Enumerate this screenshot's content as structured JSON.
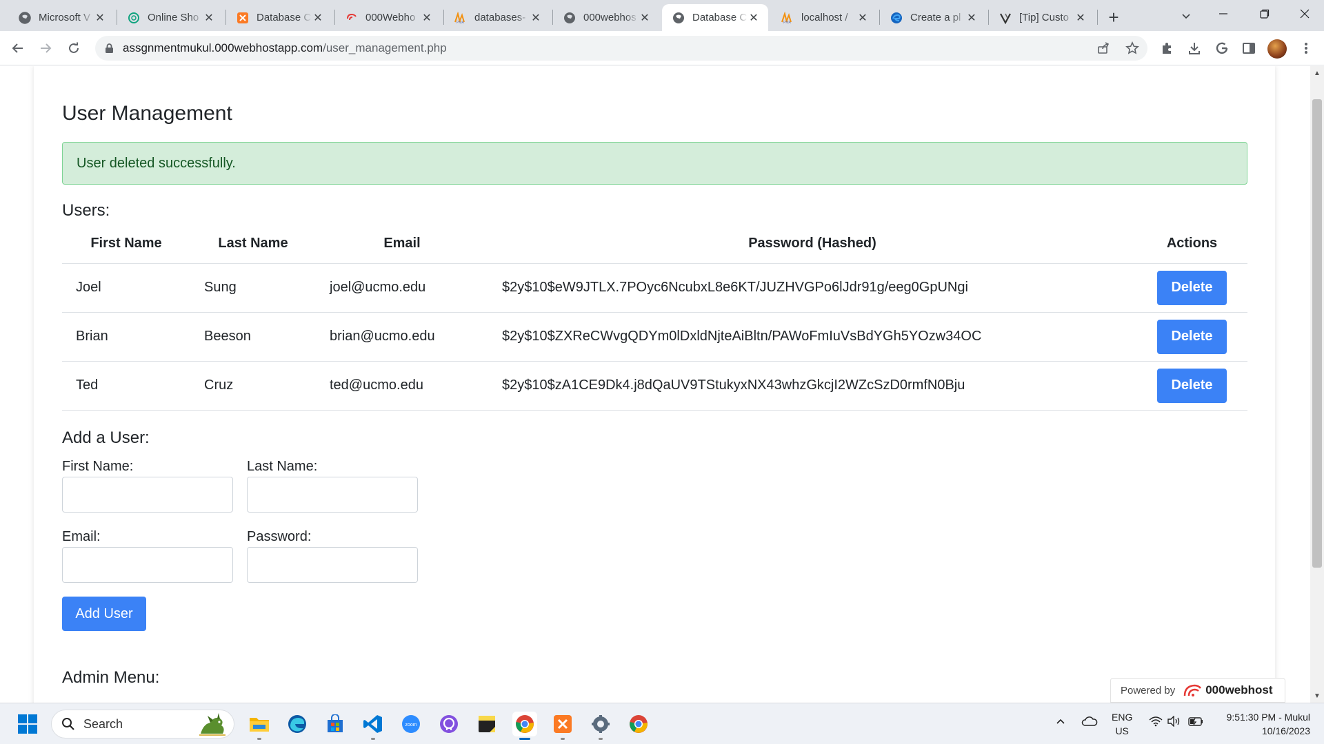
{
  "tabs": [
    {
      "title": "Microsoft V",
      "icon": "globe-icon"
    },
    {
      "title": "Online Sho",
      "icon": "openai-icon"
    },
    {
      "title": "Database C",
      "icon": "xampp-icon"
    },
    {
      "title": "000Webho",
      "icon": "webhost-icon"
    },
    {
      "title": "databases-",
      "icon": "phpmyadmin-icon"
    },
    {
      "title": "000webhos",
      "icon": "globe-icon"
    },
    {
      "title": "Database C",
      "icon": "globe-icon",
      "active": true
    },
    {
      "title": "localhost /",
      "icon": "phpmyadmin-icon"
    },
    {
      "title": "Create a pl",
      "icon": "edge-icon"
    },
    {
      "title": "[Tip] Custo",
      "icon": "tip-icon"
    }
  ],
  "address": {
    "domain": "assgnmentmukul.000webhostapp.com",
    "path": "/user_management.php"
  },
  "page": {
    "title": "User Management",
    "alert": "User deleted successfully.",
    "users_heading": "Users:",
    "table": {
      "headers": [
        "First Name",
        "Last Name",
        "Email",
        "Password (Hashed)",
        "Actions"
      ],
      "rows": [
        {
          "first": "Joel",
          "last": "Sung",
          "email": "joel@ucmo.edu",
          "password": "$2y$10$eW9JTLX.7POyc6NcubxL8e6KT/JUZHVGPo6lJdr91g/eeg0GpUNgi",
          "action": "Delete"
        },
        {
          "first": "Brian",
          "last": "Beeson",
          "email": "brian@ucmo.edu",
          "password": "$2y$10$ZXReCWvgQDYm0lDxldNjteAiBltn/PAWoFmIuVsBdYGh5YOzw34OC",
          "action": "Delete"
        },
        {
          "first": "Ted",
          "last": "Cruz",
          "email": "ted@ucmo.edu",
          "password": "$2y$10$zA1CE9Dk4.j8dQaUV9TStukyxNX43whzGkcjI2WZcSzD0rmfN0Bju",
          "action": "Delete"
        }
      ]
    },
    "add_user": {
      "heading": "Add a User:",
      "first_name_label": "First Name:",
      "last_name_label": "Last Name:",
      "email_label": "Email:",
      "password_label": "Password:",
      "first_name_value": "",
      "last_name_value": "",
      "email_value": "",
      "password_value": "",
      "submit_label": "Add User"
    },
    "admin_heading": "Admin Menu:",
    "powered_by": {
      "prefix": "Powered by",
      "brand": "000webhost"
    }
  },
  "taskbar": {
    "search_label": "Search",
    "apps": [
      "file-explorer-icon",
      "edge-icon",
      "store-icon",
      "vscode-icon",
      "zoom-icon",
      "github-icon",
      "sticky-notes-icon",
      "chrome-icon",
      "xampp-icon",
      "settings-icon",
      "chrome-icon"
    ],
    "lang_line1": "ENG",
    "lang_line2": "US",
    "time": "9:51:30 PM - Mukul",
    "date": "10/16/2023"
  },
  "colors": {
    "primary_button": "#3b82f6",
    "alert_bg": "#d4edda",
    "alert_text": "#155724",
    "alert_border": "#7fd495"
  }
}
